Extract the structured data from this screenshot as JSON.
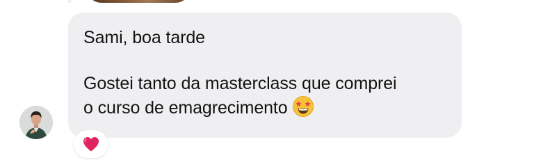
{
  "conversation": {
    "previous_message": {
      "type": "media",
      "icon": "photo-preview"
    },
    "message": {
      "sender_avatar_icon": "person-avatar",
      "lines": [
        "Sami, boa tarde",
        "",
        "Gostei tanto da masterclass que comprei",
        "o curso de emagrecimento"
      ],
      "trailing_emoji": "star-struck-emoji",
      "bubble_color": "#efeff1",
      "text_color": "#121212"
    },
    "reaction": {
      "icon": "red-heart-emoji",
      "color": "#e0245e"
    }
  }
}
